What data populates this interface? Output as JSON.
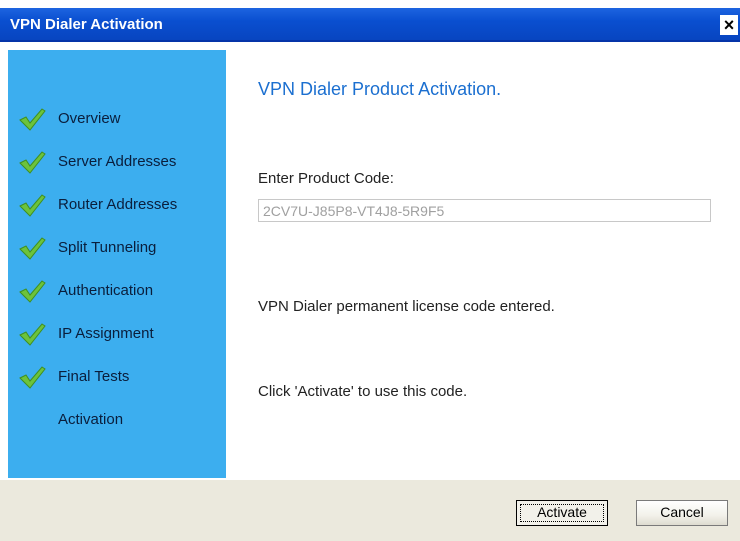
{
  "window": {
    "title": "VPN Dialer Activation",
    "close_glyph": "×"
  },
  "sidebar": {
    "steps": [
      {
        "label": "Overview",
        "done": true
      },
      {
        "label": "Server Addresses",
        "done": true
      },
      {
        "label": "Router Addresses",
        "done": true
      },
      {
        "label": "Split Tunneling",
        "done": true
      },
      {
        "label": "Authentication",
        "done": true
      },
      {
        "label": "IP Assignment",
        "done": true
      },
      {
        "label": "Final Tests",
        "done": true
      },
      {
        "label": "Activation",
        "done": false
      }
    ],
    "check_icon": "green-checkmark-icon"
  },
  "main": {
    "heading": "VPN Dialer Product Activation.",
    "product_code_label": "Enter Product Code:",
    "product_code_value": "2CV7U-J85P8-VT4J8-5R9F5",
    "status_text": "VPN Dialer permanent license code entered.",
    "hint_text": "Click 'Activate' to use this code."
  },
  "footer": {
    "activate_label": "Activate",
    "cancel_label": "Cancel"
  },
  "colors": {
    "title_bar": "#0a4fd0",
    "sidebar": "#3caeef",
    "heading": "#1b6fd0",
    "footer": "#ebe9dd"
  }
}
